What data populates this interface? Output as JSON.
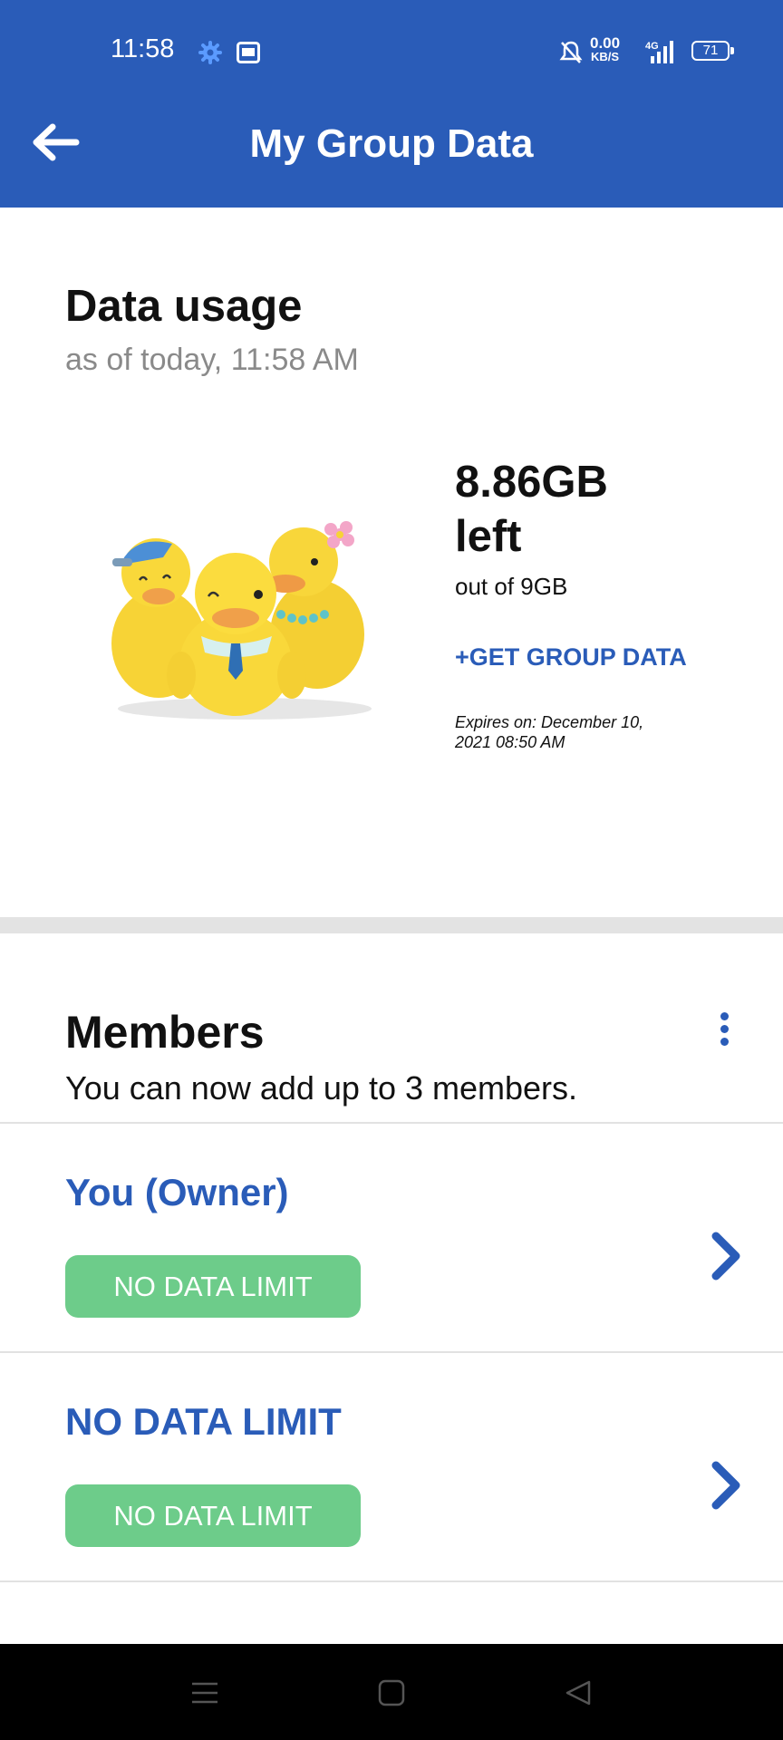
{
  "status_bar": {
    "time": "11:58",
    "net_speed_value": "0.00",
    "net_speed_unit": "KB/S",
    "network_type": "4G",
    "battery": "71",
    "icons": [
      "settings-icon",
      "screenshot-icon",
      "bell-muted-icon",
      "signal-icon",
      "battery-icon"
    ]
  },
  "header": {
    "title": "My Group Data",
    "back_icon": "back-arrow-icon",
    "color": "#2a5cb8"
  },
  "usage": {
    "title": "Data usage",
    "subtitle": "as of today, 11:58 AM",
    "amount_left": "8.86GB",
    "left_label": "left",
    "total": "out of 9GB",
    "get_more_label": "+GET GROUP DATA",
    "expires": "Expires on: December 10, 2021 08:50 AM"
  },
  "members": {
    "title": "Members",
    "subtitle": "You can now add up to 3 members.",
    "menu_icon": "more-vert-icon",
    "list": [
      {
        "name": "You (Owner)",
        "limit": "NO DATA LIMIT"
      },
      {
        "name": "NO DATA LIMIT",
        "limit": "NO DATA LIMIT"
      }
    ],
    "pill_color": "#6dcc8a"
  },
  "nav_bar": {
    "icons": [
      "menu-icon",
      "home-square-icon",
      "back-triangle-icon"
    ]
  }
}
